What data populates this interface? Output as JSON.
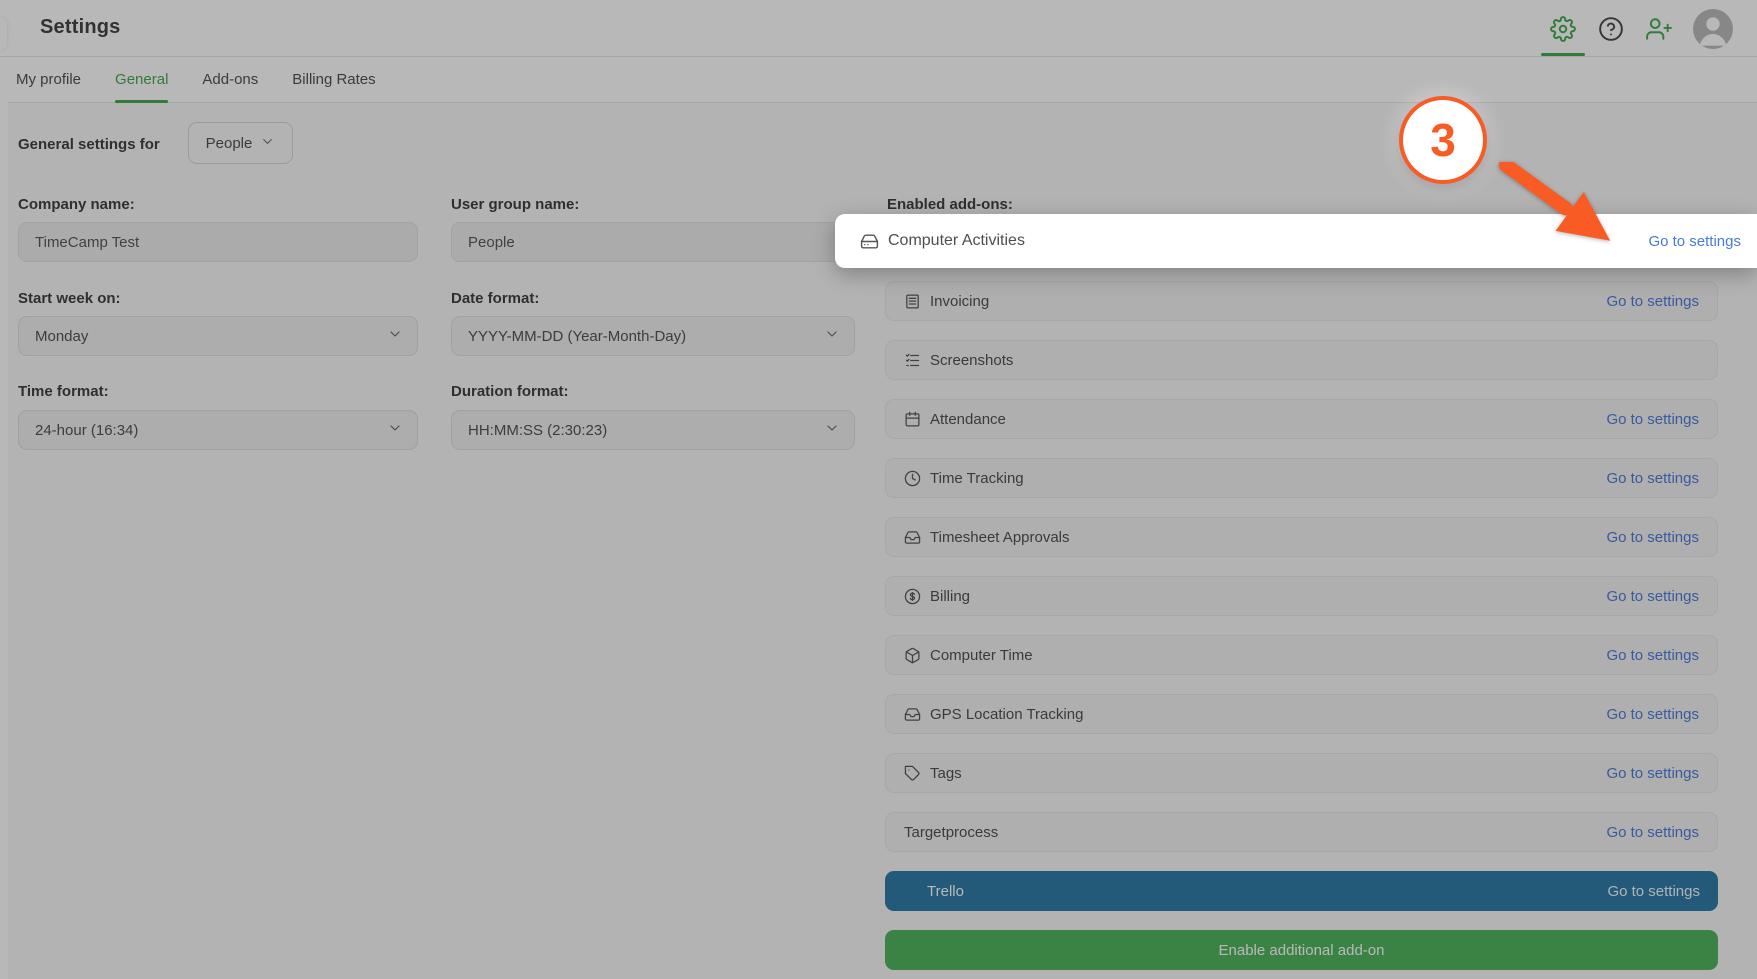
{
  "colors": {
    "accent-green": "#3ea94b",
    "enable-green": "#4db35b",
    "link-blue": "#4a79dc",
    "annotation-orange": "#f95b25",
    "trello-blue": "#2a78a5"
  },
  "header": {
    "title": "Settings",
    "icons": [
      "gear-icon",
      "help-icon",
      "add-user-icon",
      "avatar"
    ]
  },
  "tabs": {
    "items": [
      {
        "label": "My profile",
        "active": false
      },
      {
        "label": "General",
        "active": true
      },
      {
        "label": "Add-ons",
        "active": false
      },
      {
        "label": "Billing Rates",
        "active": false
      }
    ]
  },
  "general_for": {
    "label": "General settings for",
    "value": "People"
  },
  "form": {
    "company_name": {
      "label": "Company name:",
      "value": "TimeCamp Test"
    },
    "user_group_name": {
      "label": "User group name:",
      "value": "People"
    },
    "start_week": {
      "label": "Start week on:",
      "value": "Monday"
    },
    "date_format": {
      "label": "Date format:",
      "value": "YYYY-MM-DD (Year-Month-Day)"
    },
    "time_format": {
      "label": "Time format:",
      "value": "24-hour (16:34)"
    },
    "duration_format": {
      "label": "Duration format:",
      "value": "HH:MM:SS (2:30:23)"
    }
  },
  "addons": {
    "label": "Enabled add-ons:",
    "go_to_settings": "Go to settings",
    "items": [
      {
        "name": "Invoicing",
        "icon": "invoice",
        "link": true
      },
      {
        "name": "Screenshots",
        "icon": "checklist",
        "link": false
      },
      {
        "name": "Attendance",
        "icon": "calendar",
        "link": true
      },
      {
        "name": "Time Tracking",
        "icon": "clock",
        "link": true
      },
      {
        "name": "Timesheet Approvals",
        "icon": "inbox",
        "link": true
      },
      {
        "name": "Billing",
        "icon": "dollar",
        "link": true
      },
      {
        "name": "Computer Time",
        "icon": "cube",
        "link": true
      },
      {
        "name": "GPS Location Tracking",
        "icon": "inbox",
        "link": true
      },
      {
        "name": "Tags",
        "icon": "tag",
        "link": true
      },
      {
        "name": "Targetprocess",
        "icon": null,
        "link": true
      }
    ],
    "trello": {
      "name": "Trello",
      "link": "Go to settings"
    },
    "enable_button": "Enable additional add-on"
  },
  "tutorial": {
    "step": "3",
    "highlight": {
      "icon": "hard-drive",
      "name": "Computer Activities",
      "link": "Go to settings"
    }
  }
}
